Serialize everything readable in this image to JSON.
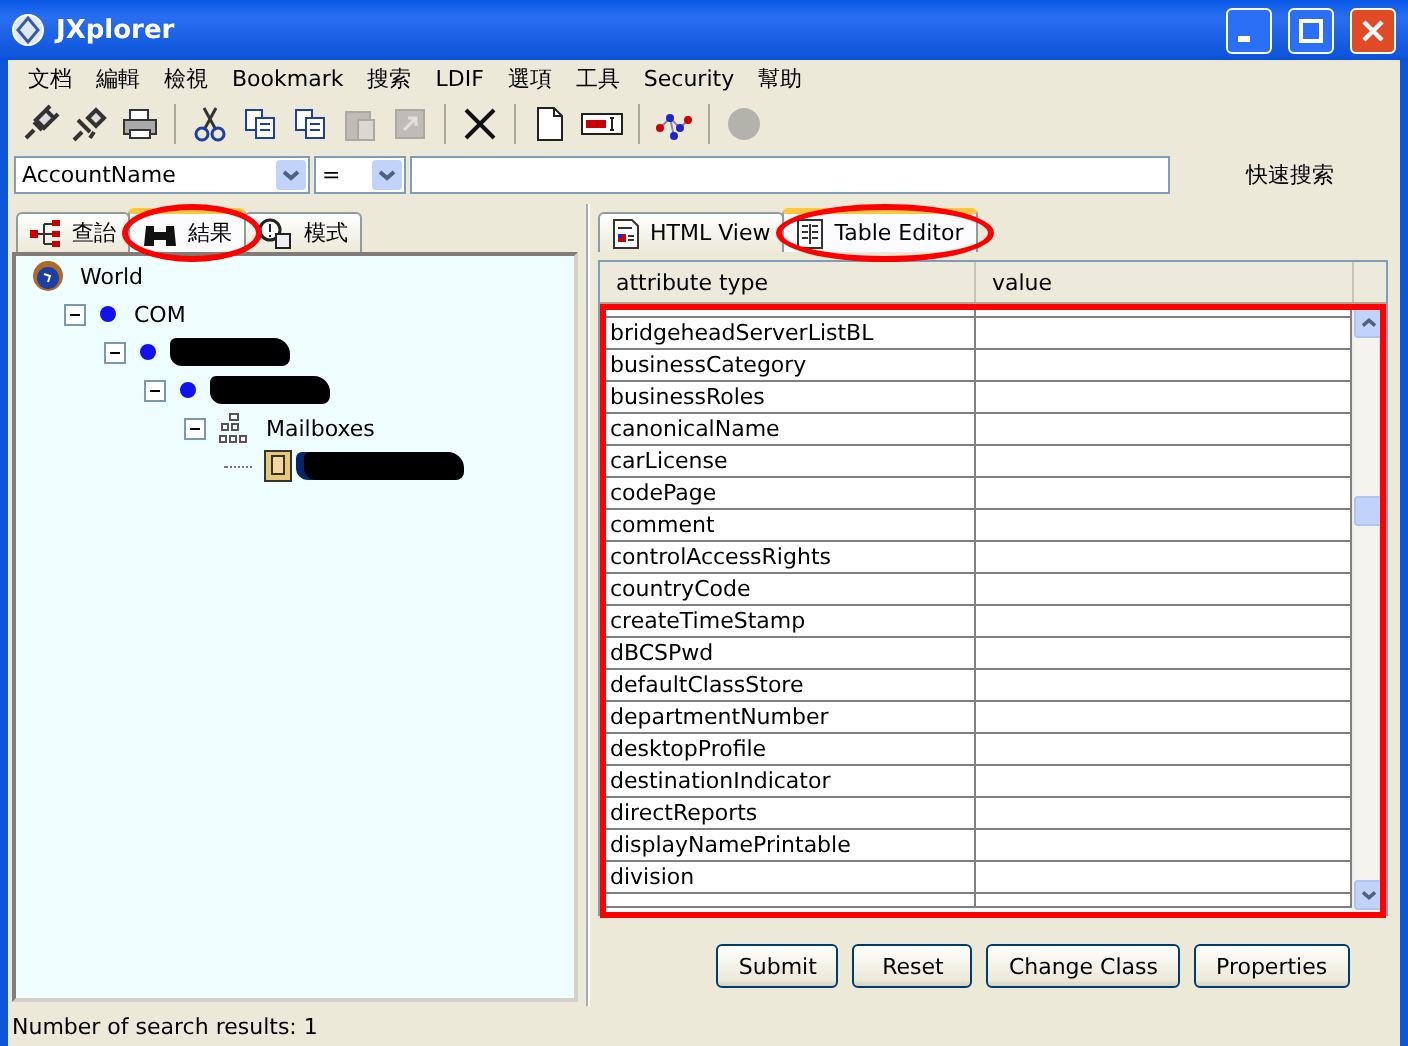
{
  "window": {
    "title": "JXplorer"
  },
  "menu": [
    "文档",
    "編輯",
    "檢視",
    "Bookmark",
    "搜索",
    "LDIF",
    "選項",
    "工具",
    "Security",
    "幫助"
  ],
  "toolbar": [
    {
      "kind": "connect",
      "disabled": false
    },
    {
      "kind": "disconnect",
      "disabled": false
    },
    {
      "kind": "print",
      "disabled": false
    },
    {
      "kind": "sep"
    },
    {
      "kind": "cut",
      "disabled": false
    },
    {
      "kind": "copy",
      "disabled": false
    },
    {
      "kind": "copy",
      "disabled": false
    },
    {
      "kind": "paste",
      "disabled": true
    },
    {
      "kind": "move",
      "disabled": true
    },
    {
      "kind": "sep"
    },
    {
      "kind": "delete",
      "disabled": false
    },
    {
      "kind": "sep"
    },
    {
      "kind": "new",
      "disabled": false
    },
    {
      "kind": "rename",
      "disabled": false
    },
    {
      "kind": "sep"
    },
    {
      "kind": "network",
      "disabled": false
    },
    {
      "kind": "sep"
    },
    {
      "kind": "stop",
      "disabled": true
    }
  ],
  "search": {
    "attribute": "AccountName",
    "operator": "=",
    "quick_search_label": "快速搜索"
  },
  "left_tabs": [
    {
      "label": "查詒",
      "kind": "tree",
      "selected": false,
      "annotated": false
    },
    {
      "label": "結果",
      "kind": "binoculars",
      "selected": true,
      "annotated": true
    },
    {
      "label": "模式",
      "kind": "schema",
      "selected": false,
      "annotated": false
    }
  ],
  "tree": [
    {
      "label": "World",
      "kind": "world",
      "children": [
        {
          "label": "COM",
          "kind": "domain",
          "expanded": true,
          "children": [
            {
              "kind": "domain",
              "redacted": true,
              "expanded": true,
              "children": [
                {
                  "kind": "domain",
                  "redacted": true,
                  "expanded": true,
                  "children": [
                    {
                      "label": "Mailboxes",
                      "kind": "container",
                      "expanded": true,
                      "children": [
                        {
                          "kind": "person",
                          "redacted": true,
                          "selected": true
                        }
                      ]
                    }
                  ]
                }
              ]
            }
          ]
        }
      ]
    }
  ],
  "right_tabs": [
    {
      "label": "HTML View",
      "kind": "html",
      "selected": false,
      "annotated": false
    },
    {
      "label": "Table Editor",
      "kind": "table",
      "selected": true,
      "annotated": true
    }
  ],
  "table": {
    "columns": [
      "attribute type",
      "value"
    ],
    "annotated": true,
    "rows": [
      {
        "attribute": "bridgeheadServerListBL"
      },
      {
        "attribute": "businessCategory"
      },
      {
        "attribute": "businessRoles"
      },
      {
        "attribute": "canonicalName"
      },
      {
        "attribute": "carLicense"
      },
      {
        "attribute": "codePage"
      },
      {
        "attribute": "comment"
      },
      {
        "attribute": "controlAccessRights"
      },
      {
        "attribute": "countryCode"
      },
      {
        "attribute": "createTimeStamp"
      },
      {
        "attribute": "dBCSPwd"
      },
      {
        "attribute": "defaultClassStore"
      },
      {
        "attribute": "departmentNumber"
      },
      {
        "attribute": "desktopProfile"
      },
      {
        "attribute": "destinationIndicator"
      },
      {
        "attribute": "directReports"
      },
      {
        "attribute": "displayNamePrintable"
      },
      {
        "attribute": "division"
      }
    ]
  },
  "buttons": [
    "Submit",
    "Reset",
    "Change Class",
    "Properties"
  ],
  "status_bar": "Number of search results: 1"
}
